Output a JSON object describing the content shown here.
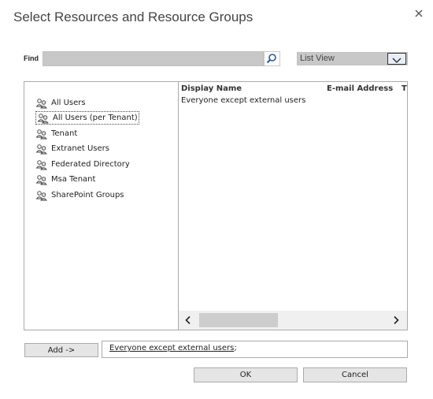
{
  "dialog": {
    "title": "Select Resources and Resource Groups"
  },
  "find": {
    "label": "Find",
    "value": ""
  },
  "view": {
    "selected": "List View"
  },
  "tree": {
    "items": [
      {
        "label": "All Users"
      },
      {
        "label": "All Users (per Tenant)",
        "selected": true
      },
      {
        "label": "Tenant"
      },
      {
        "label": "Extranet Users"
      },
      {
        "label": "Federated Directory"
      },
      {
        "label": "Msa Tenant"
      },
      {
        "label": "SharePoint Groups"
      }
    ]
  },
  "list": {
    "columns": [
      "Display Name",
      "E-mail Address",
      "T"
    ],
    "rows": [
      {
        "display_name": "Everyone except external users"
      }
    ]
  },
  "add": {
    "label": "Add ->"
  },
  "selection": {
    "link": "Everyone except external users",
    "suffix": ";"
  },
  "buttons": {
    "ok": "OK",
    "cancel": "Cancel"
  },
  "colors": {
    "input_bg": "#c8c8c8",
    "button_bg": "#e5e5e5",
    "border": "#aaaaaa"
  }
}
